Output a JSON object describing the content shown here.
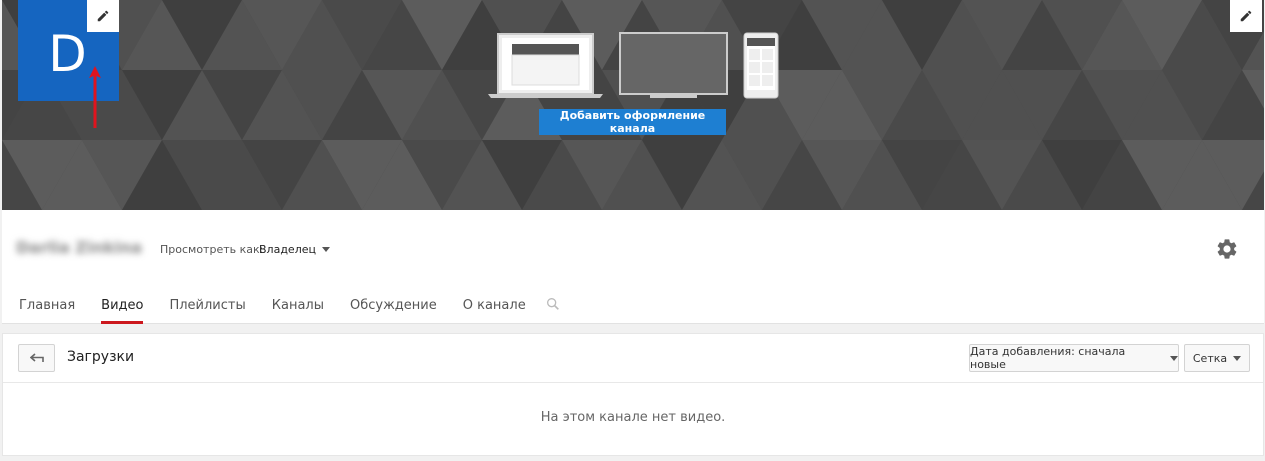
{
  "banner": {
    "avatar_letter": "D",
    "add_art_label": "Добавить оформление канала"
  },
  "header": {
    "channel_name": "Darlia Zinkina",
    "view_as_label": "Просмотреть как:",
    "view_as_value": "Владелец"
  },
  "tabs": [
    {
      "label": "Главная",
      "active": false
    },
    {
      "label": "Видео",
      "active": true
    },
    {
      "label": "Плейлисты",
      "active": false
    },
    {
      "label": "Каналы",
      "active": false
    },
    {
      "label": "Обсуждение",
      "active": false
    },
    {
      "label": "О канале",
      "active": false
    }
  ],
  "content": {
    "section_title": "Загрузки",
    "sort_label": "Дата добавления: сначала новые",
    "view_label": "Сетка",
    "empty_message": "На этом канале нет видео."
  },
  "colors": {
    "accent": "#1e7fd2",
    "avatar": "#1565c0",
    "active_tab": "#cc181e",
    "arrow": "#e0141e"
  },
  "icons": [
    "pencil-icon",
    "gear-icon",
    "search-icon",
    "back-arrow-icon",
    "laptop-icon",
    "tv-icon",
    "phone-icon"
  ]
}
